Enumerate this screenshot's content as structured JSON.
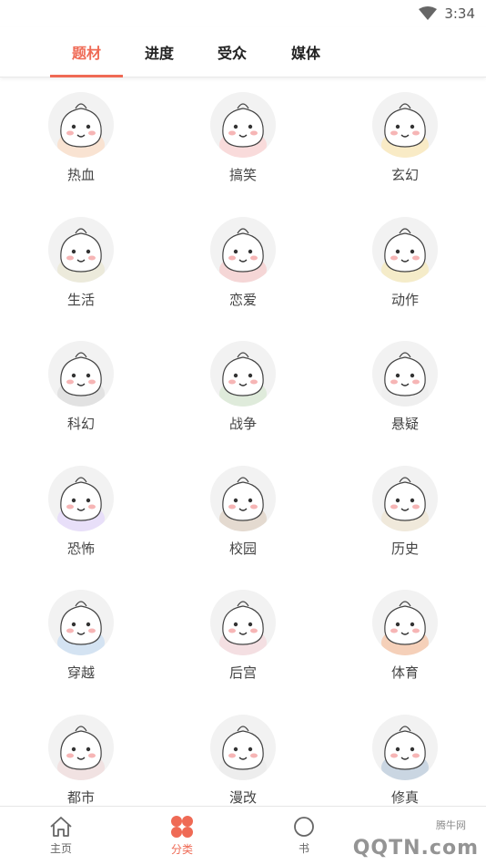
{
  "status_bar": {
    "time": "3:34"
  },
  "top_tabs": [
    {
      "label": "题材",
      "active": true
    },
    {
      "label": "进度",
      "active": false
    },
    {
      "label": "受众",
      "active": false
    },
    {
      "label": "媒体",
      "active": false
    }
  ],
  "categories": [
    {
      "label": "热血",
      "icon": "bun-fire-icon"
    },
    {
      "label": "搞笑",
      "icon": "bun-laugh-icon"
    },
    {
      "label": "玄幻",
      "icon": "bun-magic-icon"
    },
    {
      "label": "生活",
      "icon": "bun-life-icon"
    },
    {
      "label": "恋爱",
      "icon": "bun-love-icon"
    },
    {
      "label": "动作",
      "icon": "bun-action-icon"
    },
    {
      "label": "科幻",
      "icon": "bun-ufo-icon"
    },
    {
      "label": "战争",
      "icon": "bun-war-icon"
    },
    {
      "label": "悬疑",
      "icon": "bun-mystery-icon"
    },
    {
      "label": "恐怖",
      "icon": "bun-horror-icon"
    },
    {
      "label": "校园",
      "icon": "bun-school-icon"
    },
    {
      "label": "历史",
      "icon": "bun-history-icon"
    },
    {
      "label": "穿越",
      "icon": "bun-time-travel-icon"
    },
    {
      "label": "后宫",
      "icon": "bun-palace-icon"
    },
    {
      "label": "体育",
      "icon": "bun-sports-icon"
    },
    {
      "label": "都市",
      "icon": "bun-city-icon"
    },
    {
      "label": "漫改",
      "icon": "bun-comic-icon"
    },
    {
      "label": "修真",
      "icon": "bun-cultivation-icon"
    }
  ],
  "bottom_nav": [
    {
      "label": "主页",
      "icon": "home-icon",
      "active": false
    },
    {
      "label": "分类",
      "icon": "category-icon",
      "active": true
    },
    {
      "label": "书",
      "icon": "bookshelf-icon",
      "active": false
    }
  ],
  "watermark": {
    "text": "QQTN.com",
    "small": "腾牛网"
  },
  "colors": {
    "accent": "#ef6a55",
    "avatar_bg": "#f2f2f2"
  }
}
